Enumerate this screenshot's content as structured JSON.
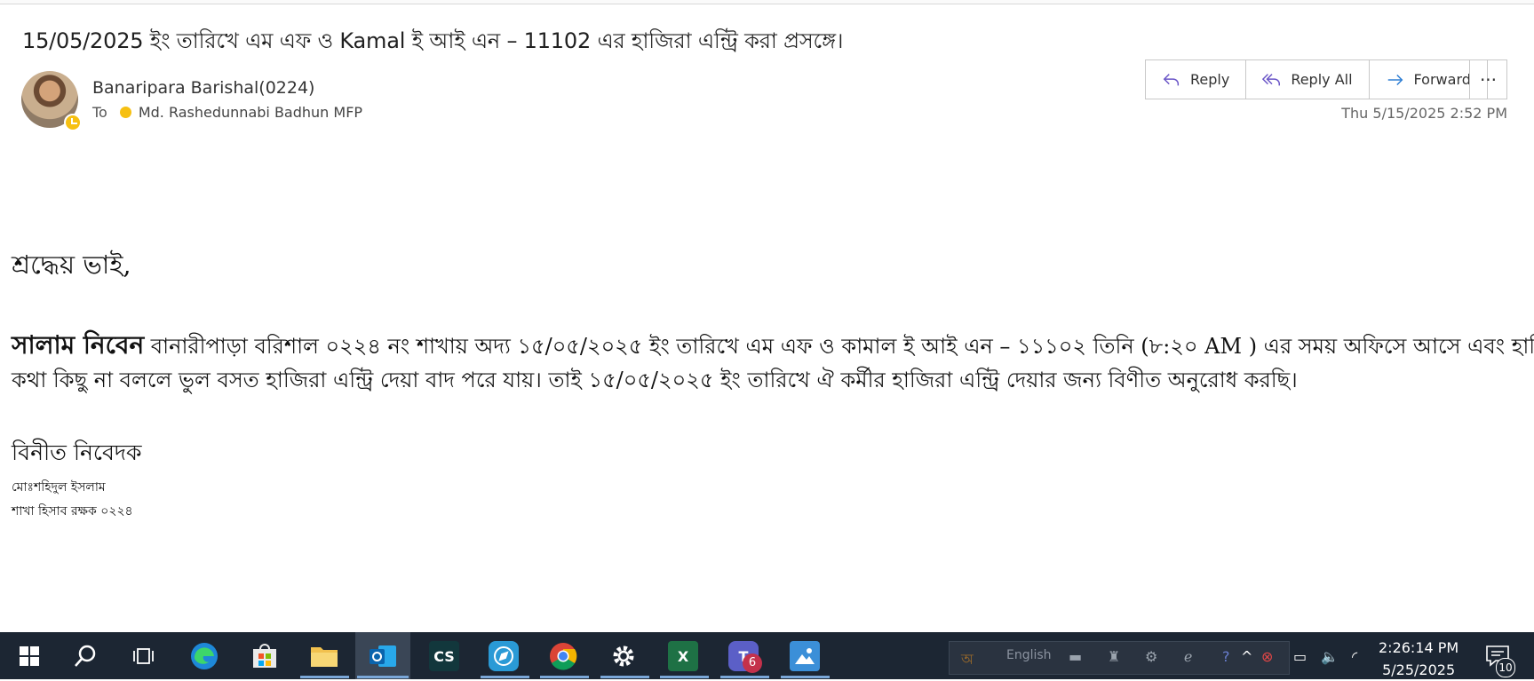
{
  "email": {
    "subject": "15/05/2025 ইং তারিখে এম এফ ও Kamal ই আই এন – 11102  এর হাজিরা  এন্ট্রি করা প্রসঙ্গে।",
    "sender": "Banaripara Barishal(0224)",
    "to_label": "To",
    "recipient": "Md. Rashedunnabi Badhun MFP",
    "date": "Thu 5/15/2025 2:52 PM"
  },
  "actions": {
    "reply": "Reply",
    "reply_all": "Reply All",
    "forward": "Forward",
    "more": "···"
  },
  "body": {
    "greeting": "শ্রদ্ধেয়  ভাই,",
    "salutation": "সালাম  নিবেন",
    "line1_rest": " বানারীপাড়া  বরিশাল ০২২৪ নং শাখায় অদ্য ১৫/০৫/২০২৫ ইং তারিখে  এম এফ ও  কামাল ই আই এন – ১১১০২   তিনি (৮:২০ AM ) এর সময় অফিসে আসে  এবং হাজিরার",
    "line2": "কথা কিছু না বললে ভুল বসত হাজিরা এন্ট্রি দেয়া বাদ পরে যায়। তাই ১৫/০৫/২০২৫ ইং তারিখে ঐ কর্মীর হাজিরা এন্ট্রি দেয়ার জন্য বিণীত অনুরোধ করছি।",
    "closing": "বিনীত নিবেদক",
    "sign_name": "মোঃশহিদুল ইসলাম",
    "sign_title": "শাখা হিসাব রক্ষক ০২২৪"
  },
  "taskbar": {
    "cs_label": "CS",
    "excel_label": "X",
    "teams_badge": "6",
    "language": "English",
    "time": "2:26:14 PM",
    "date": "5/25/2025",
    "notification_count": "10"
  },
  "icons": {
    "reply": "reply-arrow-icon",
    "reply_all": "reply-all-icon",
    "forward": "forward-arrow-icon"
  }
}
